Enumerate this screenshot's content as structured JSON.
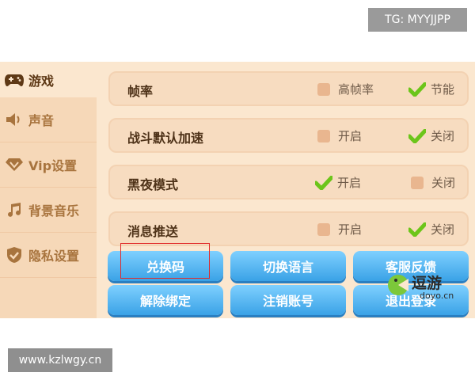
{
  "watermark_top": "TG: MYYJJPP",
  "watermark_bottom": "www.kzlwgy.cn",
  "sidebar": {
    "items": [
      {
        "label": "游戏"
      },
      {
        "label": "声音"
      },
      {
        "label": "Vip设置"
      },
      {
        "label": "背景音乐"
      },
      {
        "label": "隐私设置"
      }
    ]
  },
  "rows": [
    {
      "label": "帧率",
      "opt1": "高帧率",
      "opt2": "节能",
      "selected": "opt2"
    },
    {
      "label": "战斗默认加速",
      "opt1": "开启",
      "opt2": "关闭",
      "selected": "opt2"
    },
    {
      "label": "黑夜模式",
      "opt1": "开启",
      "opt2": "关闭",
      "selected": "opt1"
    },
    {
      "label": "消息推送",
      "opt1": "开启",
      "opt2": "关闭",
      "selected": "opt2"
    }
  ],
  "buttons": {
    "redeem": "兑换码",
    "language": "切换语言",
    "support": "客服反馈",
    "unbind": "解除绑定",
    "cancel_account": "注销账号",
    "logout": "退出登录"
  },
  "logo": {
    "cn": "逗游",
    "en": "doyo.cn"
  },
  "colors": {
    "accent_check": "#6cc51a",
    "button": "#3aa2e6",
    "highlight": "#e02a2a"
  }
}
